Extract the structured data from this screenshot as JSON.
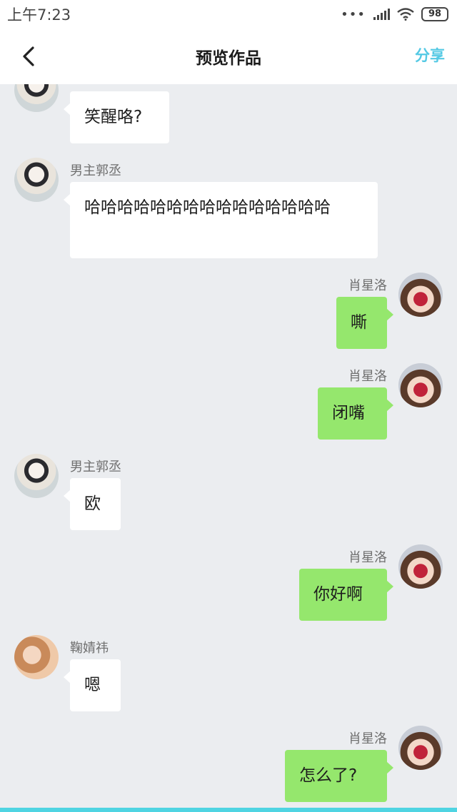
{
  "status_bar": {
    "time": "上午7:23",
    "signal_dots": "•••",
    "battery": "98"
  },
  "nav": {
    "title": "预览作品",
    "share_label": "分享"
  },
  "colors": {
    "accent": "#54c9e4",
    "bubble_self": "#95e76d",
    "bubble_other": "#ffffff",
    "chat_background": "#ebedf0"
  },
  "messages": [
    {
      "side": "left",
      "sender": "",
      "text": "笑醒咯?"
    },
    {
      "side": "left",
      "sender": "男主郭丞",
      "text": "哈哈哈哈哈哈哈哈哈哈哈哈哈哈哈"
    },
    {
      "side": "right",
      "sender": "肖星洛",
      "text": "嘶"
    },
    {
      "side": "right",
      "sender": "肖星洛",
      "text": "闭嘴"
    },
    {
      "side": "left",
      "sender": "男主郭丞",
      "text": "欧"
    },
    {
      "side": "right",
      "sender": "肖星洛",
      "text": "你好啊"
    },
    {
      "side": "left",
      "sender": "鞠婧祎",
      "text": "嗯"
    },
    {
      "side": "right",
      "sender": "肖星洛",
      "text": "怎么了?"
    }
  ]
}
